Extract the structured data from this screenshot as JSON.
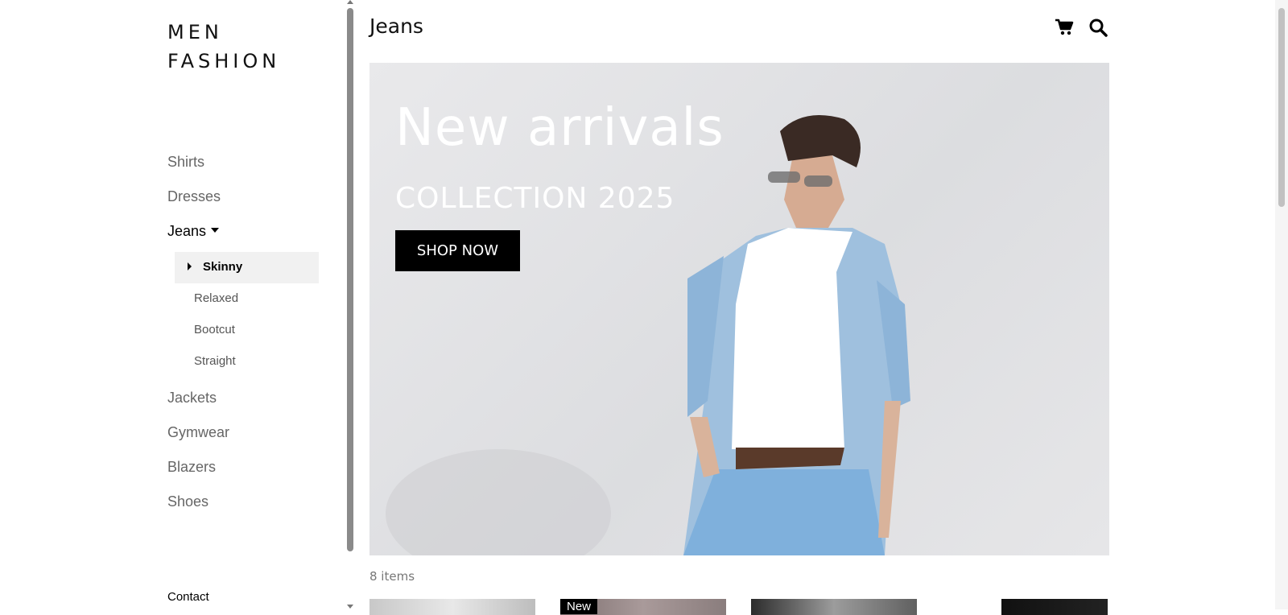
{
  "brand": {
    "line1": "MEN",
    "line2": "FASHION"
  },
  "sidebar": {
    "items_top": [
      {
        "label": "Shirts"
      },
      {
        "label": "Dresses"
      }
    ],
    "active": {
      "label": "Jeans"
    },
    "sub_items": [
      {
        "label": "Skinny"
      },
      {
        "label": "Relaxed"
      },
      {
        "label": "Bootcut"
      },
      {
        "label": "Straight"
      }
    ],
    "items_bottom": [
      {
        "label": "Jackets"
      },
      {
        "label": "Gymwear"
      },
      {
        "label": "Blazers"
      },
      {
        "label": "Shoes"
      }
    ],
    "contact": "Contact"
  },
  "header": {
    "title": "Jeans",
    "icons": [
      "cart-icon",
      "search-icon"
    ]
  },
  "hero": {
    "title": "New arrivals",
    "subtitle": "COLLECTION 2025",
    "button": "SHOP NOW"
  },
  "listing": {
    "count": "8 items",
    "badge": "New"
  },
  "colors": {
    "accent": "#000000",
    "muted": "#666666",
    "subnav_bg": "#f1f1f1"
  }
}
